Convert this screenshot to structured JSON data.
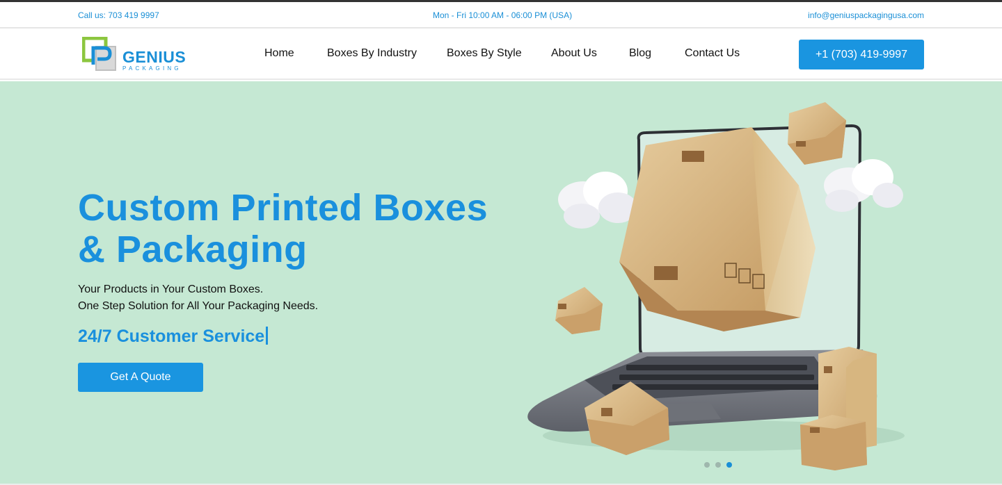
{
  "topbar": {
    "phone": "Call us: 703 419 9997",
    "hours": "Mon - Fri 10:00 AM - 06:00 PM (USA)",
    "email": "info@geniuspackagingusa.com"
  },
  "brand": {
    "name": "GENIUS",
    "tagline": "PACKAGING",
    "primary_color": "#1a90dd",
    "logo_accent_color": "#8cc63f"
  },
  "nav": {
    "items": [
      "Home",
      "Boxes By Industry",
      "Boxes By Style",
      "About Us",
      "Blog",
      "Contact Us"
    ],
    "call_button": "+1 (703) 419-9997"
  },
  "hero": {
    "title_line1": "Custom Printed Boxes",
    "title_line2": "& Packaging",
    "subtitle_line1": "Your Products in Your Custom Boxes.",
    "subtitle_line2": "One Step Solution for All Your Packaging Needs.",
    "service_text": "24/7 Customer Service",
    "cta": "Get A Quote",
    "background_color": "#c5e8d3"
  },
  "slider": {
    "total": 3,
    "active": 3
  }
}
